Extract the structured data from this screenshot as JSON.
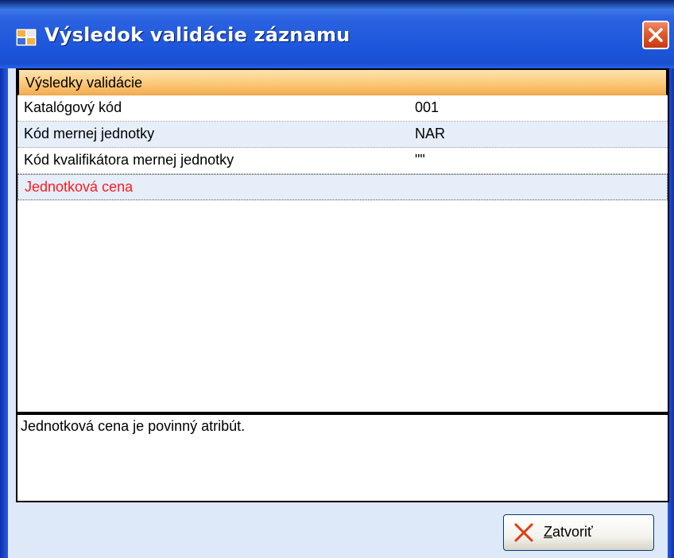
{
  "window": {
    "title": "Výsledok validácie záznamu",
    "title_icon": "app-window-icon",
    "close_icon": "close-icon"
  },
  "grid": {
    "header": "Výsledky validácie",
    "rows": [
      {
        "name": "Katalógový kód",
        "value": "001",
        "error": false
      },
      {
        "name": "Kód mernej jednotky",
        "value": "NAR",
        "error": false
      },
      {
        "name": "Kód kvalifikátora mernej jednotky",
        "value": "\"\"",
        "error": false
      },
      {
        "name": "Jednotková cena",
        "value": "",
        "error": true
      }
    ]
  },
  "message": {
    "text": "Jednotková cena je povinný atribút."
  },
  "footer": {
    "close_label_mnemonic": "Z",
    "close_label_rest": "atvoriť",
    "close_icon": "red-x-icon"
  },
  "colors": {
    "error_text": "#ff1a1a",
    "header_accent": "#fbc978",
    "titlebar": "#1d56db"
  }
}
